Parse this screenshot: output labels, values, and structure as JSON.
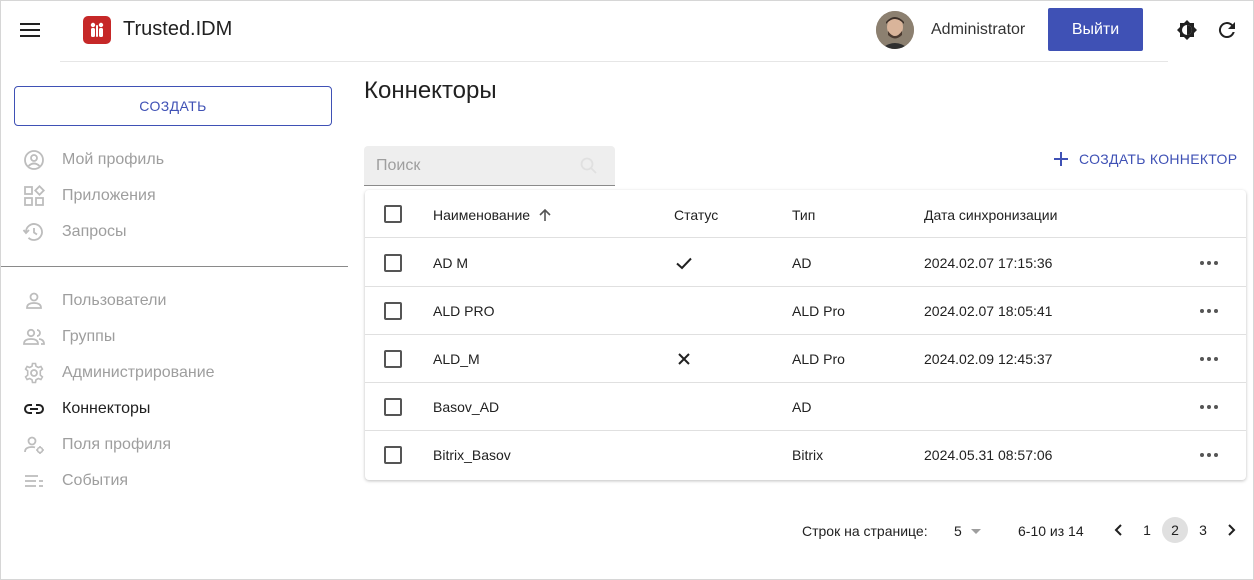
{
  "header": {
    "app_title": "Trusted.IDM",
    "user_name": "Administrator",
    "logout_label": "Выйти"
  },
  "sidebar": {
    "create_label": "СОЗДАТЬ",
    "items_top": [
      {
        "label": "Мой профиль",
        "icon": "account-circle-icon"
      },
      {
        "label": "Приложения",
        "icon": "apps-icon"
      },
      {
        "label": "Запросы",
        "icon": "history-icon"
      }
    ],
    "items_bottom": [
      {
        "label": "Пользователи",
        "icon": "person-icon"
      },
      {
        "label": "Группы",
        "icon": "people-icon"
      },
      {
        "label": "Администрирование",
        "icon": "gear-icon"
      },
      {
        "label": "Коннекторы",
        "icon": "link-icon",
        "active": true
      },
      {
        "label": "Поля профиля",
        "icon": "person-settings-icon"
      },
      {
        "label": "События",
        "icon": "event-list-icon"
      }
    ]
  },
  "main": {
    "title": "Коннекторы",
    "search_placeholder": "Поиск",
    "create_connector_label": "СОЗДАТЬ КОННЕКТОР"
  },
  "table": {
    "columns": [
      "Наименование",
      "Статус",
      "Тип",
      "Дата синхронизации"
    ],
    "sort_column": "Наименование",
    "sort_direction": "ascending",
    "rows": [
      {
        "name": "AD M",
        "status": "check",
        "type": "AD",
        "date": "2024.02.07 17:15:36"
      },
      {
        "name": "ALD PRO",
        "status": "",
        "type": "ALD Pro",
        "date": "2024.02.07 18:05:41"
      },
      {
        "name": "ALD_M",
        "status": "cross",
        "type": "ALD Pro",
        "date": "2024.02.09 12:45:37"
      },
      {
        "name": "Basov_AD",
        "status": "",
        "type": "AD",
        "date": ""
      },
      {
        "name": "Bitrix_Basov",
        "status": "",
        "type": "Bitrix",
        "date": "2024.05.31 08:57:06"
      }
    ]
  },
  "pagination": {
    "rows_per_page_label": "Строк на странице:",
    "rows_per_page_value": "5",
    "range_label": "6-10 из 14",
    "pages": [
      "1",
      "2",
      "3"
    ],
    "current_page": "2"
  },
  "colors": {
    "accent": "#3f51b5",
    "logo": "#c62828",
    "muted_text": "#9e9e9e"
  }
}
